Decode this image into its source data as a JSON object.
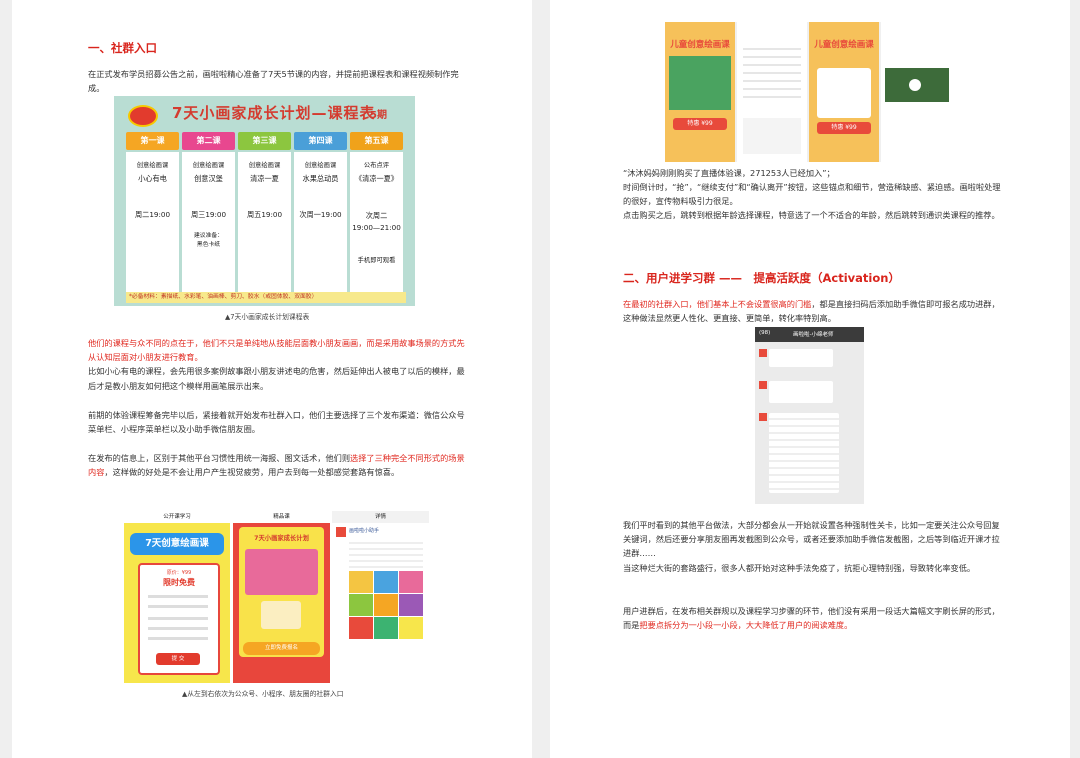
{
  "left": {
    "section1_title": "一、社群入口",
    "p1": "在正式发布学员招募公告之前，画啦啦精心准备了7天5节课的内容，并提前把课程表和课程视频制作完成。",
    "table": {
      "title": "7天小画家成长计划—课程表",
      "period": "5期",
      "columns": [
        {
          "head": "第一课",
          "color": "#f5a623",
          "a": "创意绘画课",
          "b": "小心有电",
          "c": "周二19:00",
          "d": ""
        },
        {
          "head": "第二课",
          "color": "#e8478f",
          "a": "创意绘画课",
          "b": "创意汉堡",
          "c": "周三19:00",
          "d": "建议准备：\n黑色卡纸"
        },
        {
          "head": "第三课",
          "color": "#8cc63f",
          "a": "创意绘画课",
          "b": "清凉一夏",
          "c": "周五19:00",
          "d": ""
        },
        {
          "head": "第四课",
          "color": "#4a9fd8",
          "a": "创意绘画课",
          "b": "水果总动员",
          "c": "次周一19:00",
          "d": ""
        },
        {
          "head": "第五课",
          "color": "#f0a21b",
          "a": "公布点评",
          "b": "《清凉一夏》",
          "c": "次周二\n19:00—21:00",
          "d": "手机即可观看"
        }
      ],
      "materials": "*必备材料：素描纸、水彩笔、油画棒、剪刀、胶水（或固体胶、双面胶）"
    },
    "caption1": "▲7天小画家成长计划课程表",
    "p2_red": "他们的课程与众不同的点在于，他们不只是单纯地从技能层面教小朋友画画，而是采用故事场景的方式先从认知层面对小朋友进行教育。",
    "p2_rest": "比如小心有电的课程，会先用很多案例故事跟小朋友讲述电的危害，然后延伸出人被电了以后的模样，最后才是教小朋友如何把这个模样用画笔展示出来。",
    "p3": "前期的体验课程筹备完毕以后，紧接着就开始发布社群入口，他们主要选择了三个发布渠道：微信公众号菜单栏、小程序菜单栏以及小助手微信朋友圈。",
    "p4_a": "在发布的信息上，区别于其他平台习惯性用统一海报、图文话术，他们则",
    "p4_red": "选择了三种完全不同形式的场景内容",
    "p4_b": "，这样做的好处是不会让用户产生视觉疲劳，用户去到每一处都感觉套路有惊喜。",
    "phones": {
      "p1_nav": "公开课学习",
      "p1_title": "7天创意绘画课",
      "p1_price": "原价：¥99",
      "p1_free": "限时免费",
      "p1_btn": "提 交",
      "p2_nav": "精品课",
      "p2_title": "7天小画家成长计划",
      "p2_btn": "立即免费报名",
      "p3_nav": "详情",
      "p3_name": "画啦啦小助手"
    },
    "caption2": "▲从左到右依次为公众号、小程序、朋友圈的社群入口"
  },
  "right": {
    "top_phones": {
      "banner": "儿童创意绘画课",
      "price": "特惠 ¥99"
    },
    "p1": "“沐沐妈妈刚刚购买了直播体验课，271253人已经加入”；",
    "p2": "时间倒计时，“抢”，“继续支付”和“确认离开”按钮，这些锚点和细节，营造稀缺感、紧迫感。画啦啦处理的很好，宣传物料吸引力很足。",
    "p3": "点击购买之后，跳转到根据年龄选择课程，特意选了一个不适合的年龄，然后跳转到通识类课程的推荐。",
    "section2_title": "二、用户进学习群 ——　提高活跃度（Activation）",
    "p4_red": "在最初的社群入口，他们基本上不会设置很高的门槛",
    "p4_rest": "，都是直接扫码后添加助手微信即可报名成功进群，这种做法显然更人性化、更直接、更简单，转化率特别高。",
    "chat": {
      "title": "画啦啦-小绵老师",
      "count": "(98)"
    },
    "p5": "我们平时看到的其他平台做法，大部分都会从一开始就设置各种强制性关卡，比如一定要关注公众号回复关键词，然后还要分享朋友圈再发截图到公众号，或者还要添加助手微信发截图，之后等到临近开课才拉进群……",
    "p6": "当这种烂大街的套路盛行，很多人都开始对这种手法免疫了，抗拒心理特别强，导致转化率变低。",
    "p7_a": "用户进群后，在发布相关群规以及课程学习步骤的环节，他们没有采用一段话大篇幅文字刷长屏的形式，而是",
    "p7_red": "把要点拆分为一小段一小段，大大降低了用户的阅读难度。"
  }
}
